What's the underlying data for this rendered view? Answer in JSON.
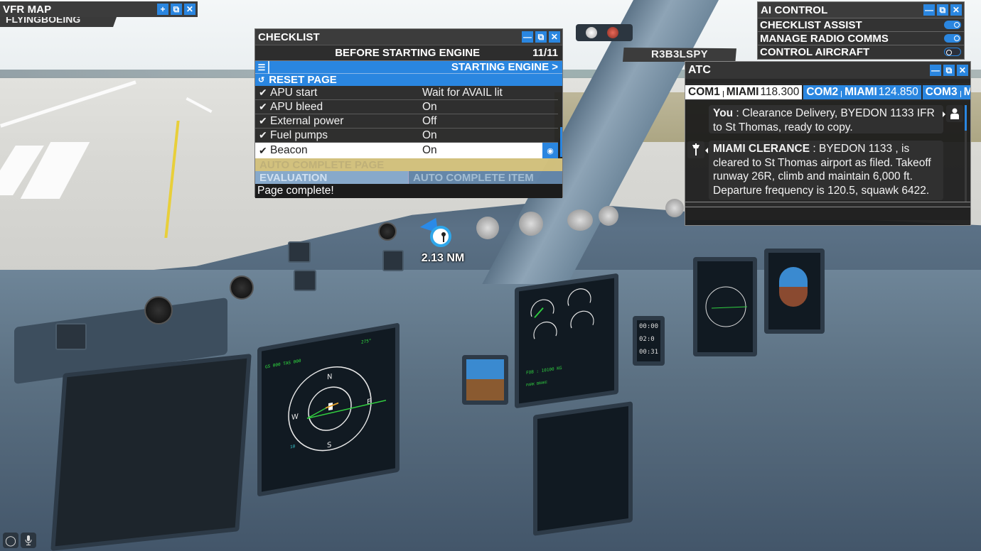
{
  "vfr_map": {
    "title": "VFR MAP",
    "subtitle": "FLYINGBOEING",
    "buttons": {
      "add": "+",
      "popout": "⧉",
      "close": "✕"
    }
  },
  "checklist": {
    "title": "CHECKLIST",
    "buttons": {
      "minimize": "—",
      "popout": "⧉",
      "close": "✕"
    },
    "page_name": "BEFORE STARTING ENGINE",
    "page_index": "11/11",
    "next_page_label": "STARTING ENGINE >",
    "reset_label": "RESET PAGE",
    "items": [
      {
        "check": "✔",
        "item": "APU start",
        "value": "Wait for AVAIL lit"
      },
      {
        "check": "✔",
        "item": "APU bleed",
        "value": "On"
      },
      {
        "check": "✔",
        "item": "External power",
        "value": "Off"
      },
      {
        "check": "✔",
        "item": "Fuel pumps",
        "value": "On"
      },
      {
        "check": "✔",
        "item": "Beacon",
        "value": "On",
        "active": true
      }
    ],
    "auto_complete_page": "AUTO COMPLETE PAGE",
    "evaluation": "EVALUATION",
    "auto_complete_item": "AUTO COMPLETE ITEM",
    "status_message": "Page complete!"
  },
  "ai_control": {
    "title": "AI CONTROL",
    "buttons": {
      "minimize": "—",
      "popout": "⧉",
      "close": "✕"
    },
    "toggles": [
      {
        "label": "CHECKLIST ASSIST",
        "on": true
      },
      {
        "label": "MANAGE RADIO COMMS",
        "on": true
      },
      {
        "label": "CONTROL AIRCRAFT",
        "on": false
      }
    ]
  },
  "name_plate": "R3B3LSPY",
  "atc": {
    "title": "ATC",
    "buttons": {
      "minimize": "—",
      "popout": "⧉",
      "close": "✕"
    },
    "tabs": [
      {
        "com": "COM1",
        "station": "MIAMI",
        "freq": "118.300",
        "selected": true
      },
      {
        "com": "COM2",
        "station": "MIAMI",
        "freq": "124.850",
        "selected": false
      },
      {
        "com": "COM3",
        "station": "MI",
        "freq": "",
        "selected": false
      }
    ],
    "messages": [
      {
        "speaker": "You",
        "sep": " : ",
        "text": "Clearance Delivery, BYEDON 1133 IFR to St Thomas, ready to copy."
      },
      {
        "speaker": "MIAMI CLERANCE",
        "sep": " : ",
        "text": "BYEDON 1133 , is cleared to St Thomas airport as filed. Takeoff runway 26R, climb and maintain 6,000 ft. Departure frequency is 120.5, squawk 6422."
      }
    ]
  },
  "waypoint": {
    "distance": "2.13 NM"
  },
  "bottom_icons": {
    "camera_icon": "◯",
    "mic_icon": "🎙"
  },
  "colors": {
    "accent_blue": "#2a86e0",
    "window_bg": "#2d2d2d",
    "auto_complete_yellow": "#eeda8c"
  }
}
